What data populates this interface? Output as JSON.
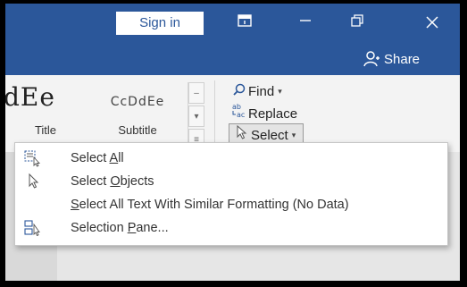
{
  "titlebar": {
    "sign_in_label": "Sign in",
    "icons": [
      "ribbon-display-options-icon",
      "minimize-icon",
      "restore-icon",
      "close-icon"
    ],
    "background_color": "#2b579a"
  },
  "share": {
    "label": "Share",
    "icon": "person-icon"
  },
  "styles_gallery": {
    "items": [
      {
        "sample": "dEe",
        "label": "Title"
      },
      {
        "sample": "CcDdEe",
        "label": "Subtitle"
      }
    ]
  },
  "editing": {
    "find_label": "Find",
    "replace_label": "Replace",
    "select_label": "Select"
  },
  "select_menu": {
    "items": [
      {
        "label": "Select All",
        "underline": "A",
        "icon": "select-all-icon"
      },
      {
        "label": "Select Objects",
        "underline": "O",
        "icon": "pointer-arrow-icon"
      },
      {
        "label": "Select All Text With Similar Formatting (No Data)",
        "underline": "S",
        "icon": "none"
      },
      {
        "label": "Selection Pane...",
        "underline": "P",
        "icon": "selection-pane-icon"
      }
    ]
  }
}
